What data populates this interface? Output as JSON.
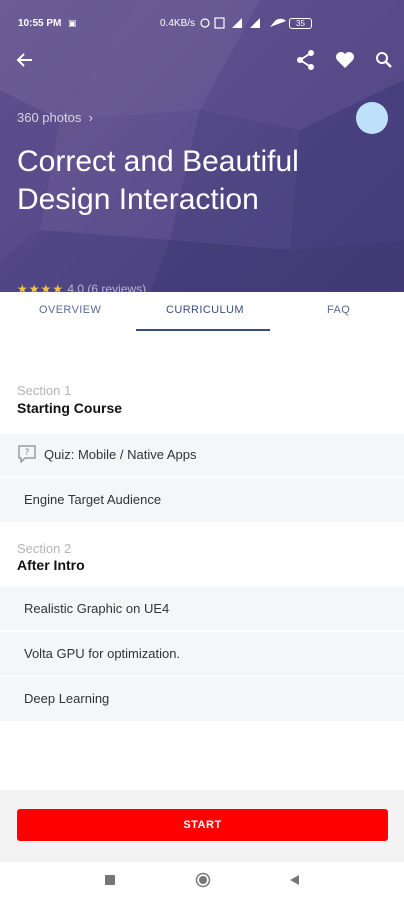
{
  "status_bar": {
    "time": "10:55 PM",
    "network_speed": "0.4KB/s",
    "battery": "35"
  },
  "toolbar": {
    "back_icon": "arrow-left-icon",
    "share_icon": "share-icon",
    "favorite_icon": "heart-icon",
    "search_icon": "search-icon"
  },
  "hero": {
    "photos_label": "360 photos",
    "title": "Correct and Beautiful Design Interaction",
    "rating_text": "4.0 (6 reviews)",
    "stars": "★★★★",
    "accent_color": "#bfe0fb"
  },
  "tabs": [
    {
      "label": "OVERVIEW"
    },
    {
      "label": "CURRICULUM"
    },
    {
      "label": "FAQ"
    }
  ],
  "curriculum": {
    "sections": [
      {
        "label": "Section 1",
        "title": "Starting Course",
        "items": [
          {
            "label": "Quiz: Mobile / Native Apps",
            "icon": "quiz-icon"
          },
          {
            "label": "Engine Target Audience"
          }
        ]
      },
      {
        "label": "Section 2",
        "title": "After Intro",
        "items": [
          {
            "label": "Realistic Graphic on UE4"
          },
          {
            "label": "Volta GPU for optimization."
          },
          {
            "label": "Deep Learning"
          }
        ]
      }
    ]
  },
  "actions": {
    "start_label": "START",
    "start_color": "#ff0000"
  },
  "navbar": {
    "recent_icon": "square-icon",
    "home_icon": "circle-icon",
    "back_icon": "triangle-back-icon"
  }
}
